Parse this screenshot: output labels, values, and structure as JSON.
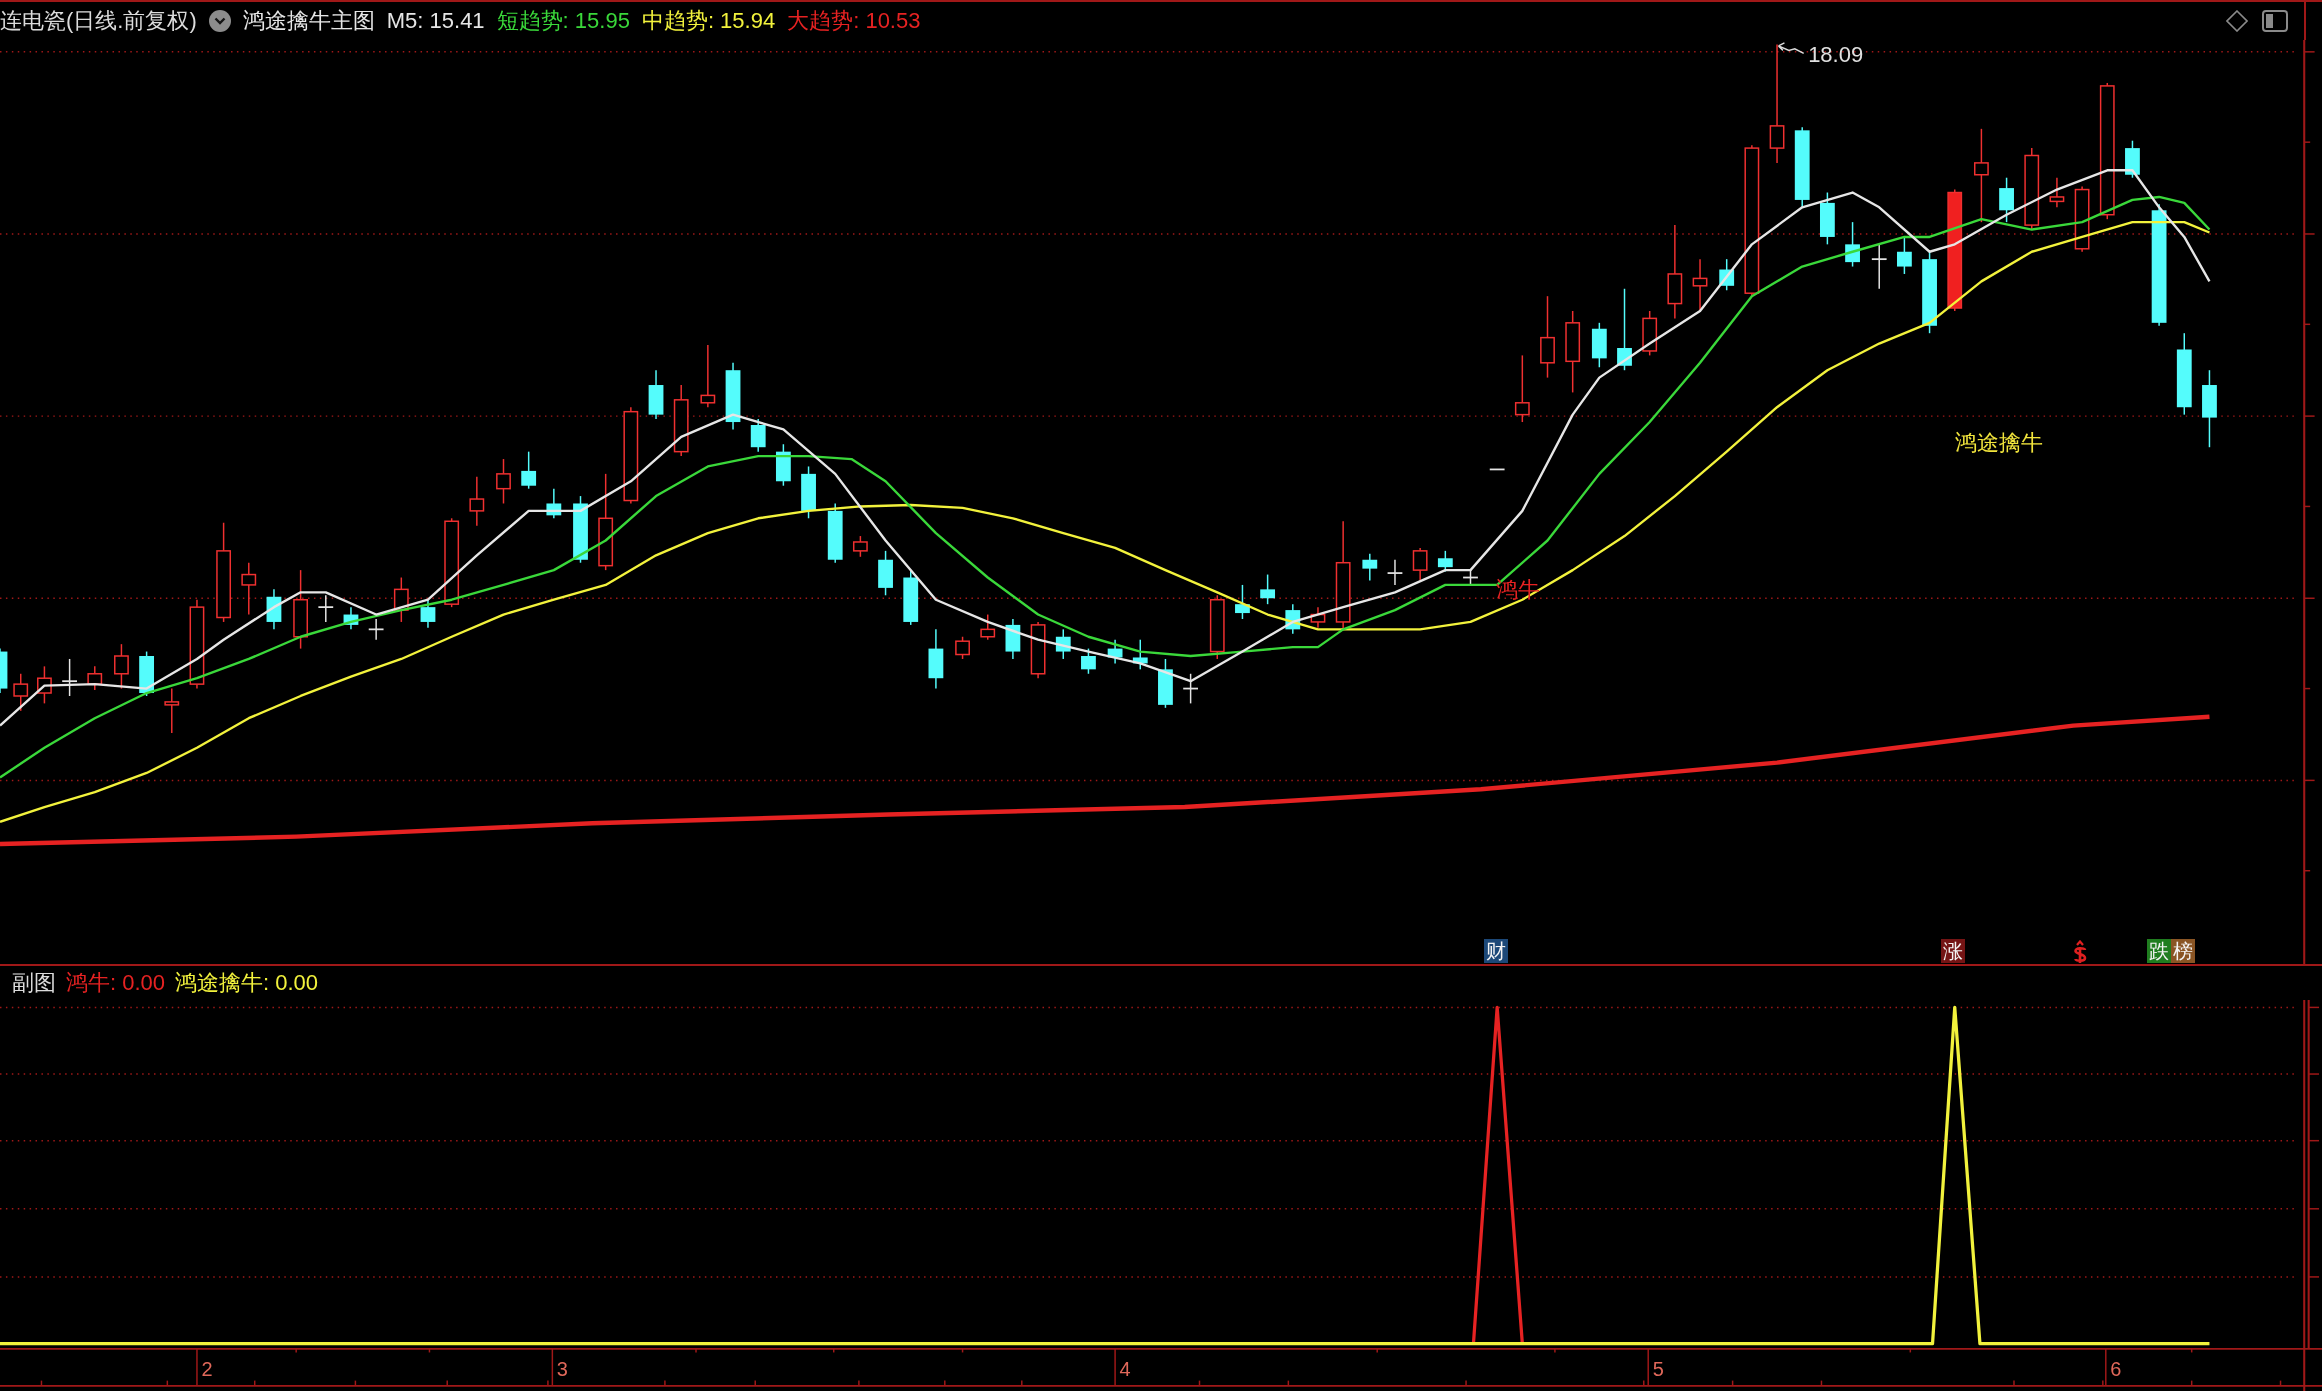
{
  "header": {
    "title": "连电瓷(日线.前复权)",
    "indicator_name": "鸿途擒牛主图",
    "indicators": [
      {
        "text": "M5: 15.41",
        "color": "#e6e6e6"
      },
      {
        "text": "短趋势: 15.95",
        "color": "#3ad83a"
      },
      {
        "text": "中趋势: 15.94",
        "color": "#f2f23c"
      },
      {
        "text": "大趋势: 10.53",
        "color": "#e62222"
      }
    ]
  },
  "main_chart": {
    "high_label": "18.09",
    "signals": [
      {
        "text": "鸿牛",
        "color": "#e62222"
      },
      {
        "text": "鸿途擒牛",
        "color": "#f2e53c"
      }
    ],
    "markers": [
      {
        "text": "财",
        "color": "#1c4878"
      },
      {
        "text": "涨",
        "color": "#741414"
      },
      {
        "text": "跌",
        "color": "#1f7d1f"
      },
      {
        "text": "榜",
        "color": "#8a5524"
      }
    ]
  },
  "sub_chart": {
    "title": "副图",
    "indicators": [
      {
        "text": "鸿牛: 0.00",
        "color": "#e62222"
      },
      {
        "text": "鸿途擒牛: 0.00",
        "color": "#f2f23c"
      }
    ]
  },
  "x_axis": {
    "labels": [
      "2",
      "3",
      "4",
      "5",
      "6"
    ]
  }
}
